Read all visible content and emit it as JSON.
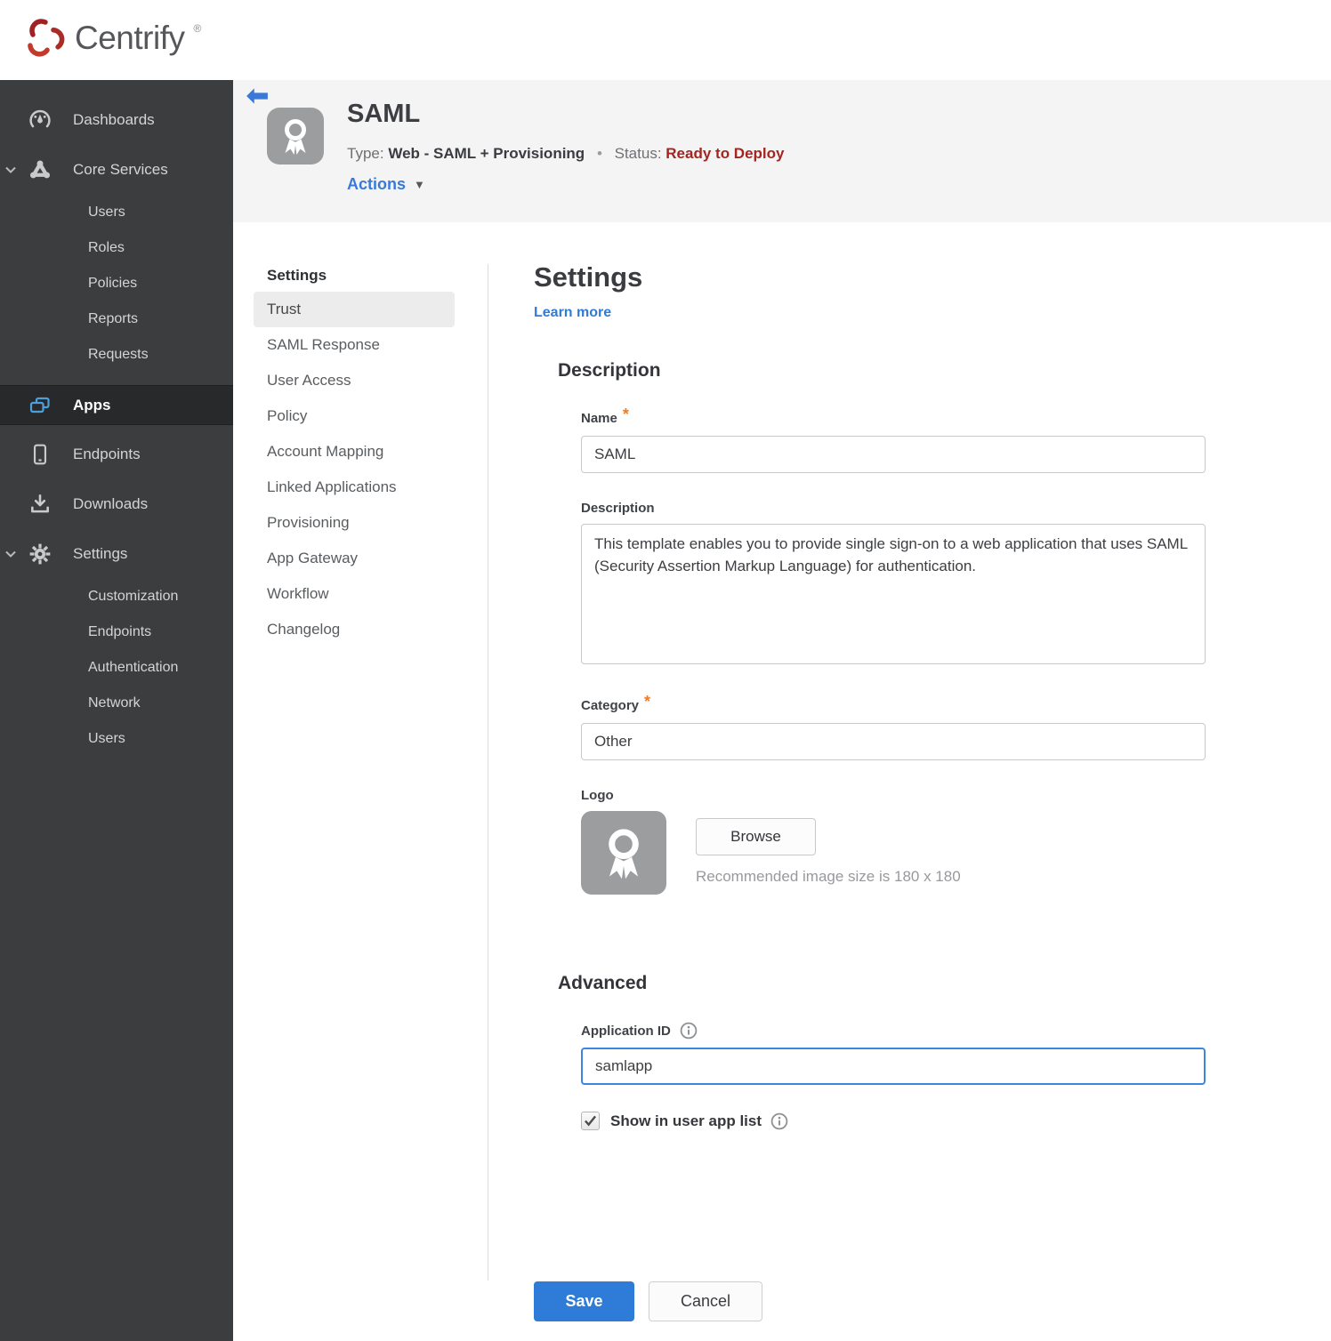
{
  "brand": {
    "name": "Centrify",
    "trademark": "®"
  },
  "sidebar": {
    "items": [
      {
        "label": "Dashboards",
        "icon": "gauge-icon"
      },
      {
        "label": "Core Services",
        "icon": "core-services-icon",
        "expanded": true
      },
      {
        "label": "Users"
      },
      {
        "label": "Roles"
      },
      {
        "label": "Policies"
      },
      {
        "label": "Reports"
      },
      {
        "label": "Requests"
      },
      {
        "label": "Apps",
        "icon": "apps-icon",
        "active": true
      },
      {
        "label": "Endpoints",
        "icon": "phone-icon"
      },
      {
        "label": "Downloads",
        "icon": "download-icon"
      },
      {
        "label": "Settings",
        "icon": "gear-icon",
        "expanded": true
      },
      {
        "label": "Customization"
      },
      {
        "label": "Endpoints"
      },
      {
        "label": "Authentication"
      },
      {
        "label": "Network"
      },
      {
        "label": "Users"
      }
    ]
  },
  "header": {
    "title": "SAML",
    "type_label": "Type:",
    "type_value": "Web - SAML + Provisioning",
    "separator": "•",
    "status_label": "Status:",
    "status_value": "Ready to Deploy",
    "actions_label": "Actions",
    "actions_caret": "▼"
  },
  "subnav": {
    "header": "Settings",
    "active_item": "Trust",
    "items": [
      "Trust",
      "SAML Response",
      "User Access",
      "Policy",
      "Account Mapping",
      "Linked Applications",
      "Provisioning",
      "App Gateway",
      "Workflow",
      "Changelog"
    ]
  },
  "main": {
    "title": "Settings",
    "learn_more": "Learn more",
    "required_marker": "*",
    "description_section": {
      "heading": "Description",
      "name_label": "Name",
      "name_value": "SAML",
      "description_label": "Description",
      "description_value": "This template enables you to provide single sign-on to a web application that uses SAML (Security Assertion Markup Language) for authentication.",
      "category_label": "Category",
      "category_value": "Other",
      "logo_label": "Logo",
      "browse_label": "Browse",
      "logo_hint": "Recommended image size is 180 x 180"
    },
    "advanced_section": {
      "heading": "Advanced",
      "app_id_label": "Application ID",
      "app_id_value": "samlapp",
      "show_in_list_label": "Show in user app list",
      "show_in_list_checked": true
    },
    "save_label": "Save",
    "cancel_label": "Cancel"
  },
  "colors": {
    "accent_blue": "#2e7bd8",
    "status_red": "#a4251f",
    "sidebar_bg": "#3b3d3f",
    "sidebar_active_bg": "#28292b",
    "header_band": "#f4f4f5",
    "apps_icon_blue": "#4ba0dc",
    "required_orange": "#f07c23"
  }
}
